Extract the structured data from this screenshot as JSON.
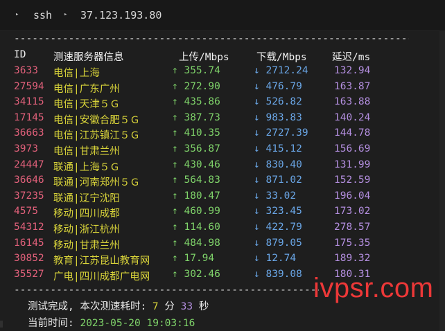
{
  "breadcrumb": {
    "seg1": "ssh",
    "seg2": "37.123.193.80",
    "arrow": "▸"
  },
  "separator": "-----------------------------------------------------------------------------------------",
  "header": {
    "id": "ID",
    "name": "测速服务器信息",
    "upload": "上传/Mbps",
    "download": "下载/Mbps",
    "latency": "延迟/ms"
  },
  "rows": [
    {
      "id": "3633",
      "name": "电信|上海",
      "up": "↑ 355.74",
      "down": "↓ 2712.24",
      "lat": "132.94"
    },
    {
      "id": "27594",
      "name": "电信|广东广州",
      "up": "↑ 272.90",
      "down": "↓ 476.79",
      "lat": "163.87"
    },
    {
      "id": "34115",
      "name": "电信|天津５Ｇ",
      "up": "↑ 435.86",
      "down": "↓ 526.82",
      "lat": "163.88"
    },
    {
      "id": "17145",
      "name": "电信|安徽合肥５Ｇ",
      "up": "↑ 387.73",
      "down": "↓ 983.83",
      "lat": "140.24"
    },
    {
      "id": "36663",
      "name": "电信|江苏镇江５Ｇ",
      "up": "↑ 410.35",
      "down": "↓ 2727.39",
      "lat": "144.78"
    },
    {
      "id": "3973",
      "name": "电信|甘肃兰州",
      "up": "↑ 356.87",
      "down": "↓ 415.12",
      "lat": "156.69"
    },
    {
      "id": "24447",
      "name": "联通|上海５Ｇ",
      "up": "↑ 430.46",
      "down": "↓ 830.40",
      "lat": "131.99"
    },
    {
      "id": "36646",
      "name": "联通|河南郑州５Ｇ",
      "up": "↑ 564.83",
      "down": "↓ 871.02",
      "lat": "152.59"
    },
    {
      "id": "37235",
      "name": "联通|辽宁沈阳",
      "up": "↑ 180.47",
      "down": "↓ 33.02",
      "lat": "196.04"
    },
    {
      "id": "4575",
      "name": "移动|四川成都",
      "up": "↑ 460.99",
      "down": "↓ 323.45",
      "lat": "173.02"
    },
    {
      "id": "54312",
      "name": "移动|浙江杭州",
      "up": "↑ 114.60",
      "down": "↓ 422.79",
      "lat": "278.57"
    },
    {
      "id": "16145",
      "name": "移动|甘肃兰州",
      "up": "↑ 484.98",
      "down": "↓ 879.05",
      "lat": "175.35"
    },
    {
      "id": "30852",
      "name": "教育|江苏昆山教育网",
      "up": "↑ 17.94",
      "down": "↓ 12.74",
      "lat": "189.32"
    },
    {
      "id": "35527",
      "name": "广电|四川成都广电网",
      "up": "↑ 302.46",
      "down": "↓ 839.08",
      "lat": "180.31"
    }
  ],
  "summary": {
    "done_label": "测试完成, 本次测速耗时: ",
    "minutes": "7",
    "min_unit": " 分 ",
    "seconds": "33",
    "sec_unit": " 秒",
    "time_label": "当前时间: ",
    "time_value": "2023-05-20 19:03:16"
  },
  "watermark": "ivpsr.com"
}
